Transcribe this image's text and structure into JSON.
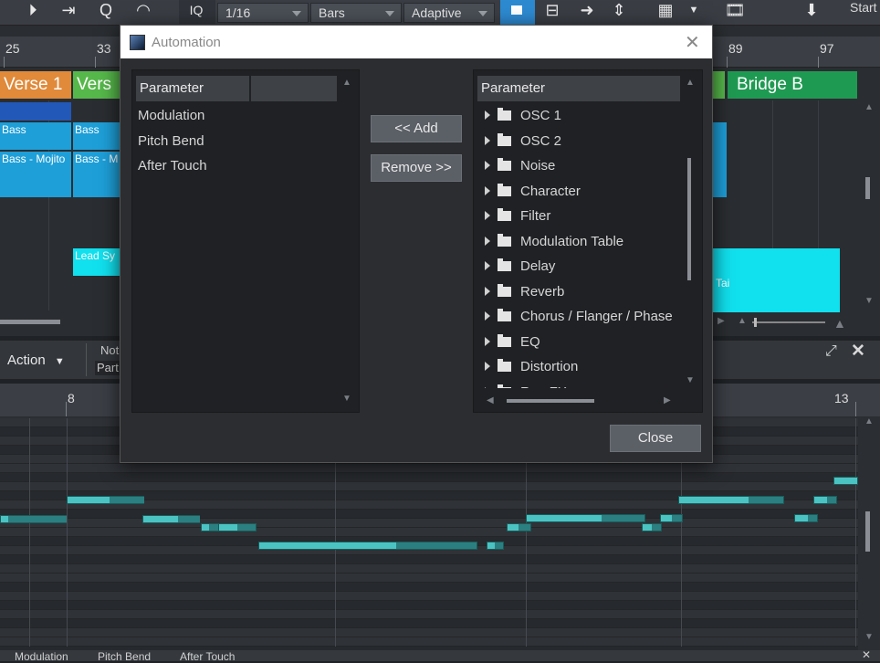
{
  "toolbar": {
    "quantize": "1/16",
    "timebase": "Bars",
    "snap": "Adaptive",
    "iq_label": "IQ",
    "start_label": "Start"
  },
  "arrangement": {
    "ruler": [
      "25",
      "33",
      "89",
      "97"
    ],
    "sections": [
      "Verse 1",
      "Vers",
      "Bridge B"
    ],
    "clips": [
      "Bass",
      "Bass",
      "Bass - Mojito",
      "Bass - M",
      "Lead Sy",
      "Tai"
    ]
  },
  "midbar": {
    "action_label": "Action",
    "note_text_1": "Not",
    "note_text_2": "Part"
  },
  "pianoroll": {
    "ruler": [
      "8",
      "13"
    ]
  },
  "bottom_tabs": [
    "Modulation",
    "Pitch Bend",
    "After Touch"
  ],
  "dialog": {
    "title": "Automation",
    "left_header": "Parameter",
    "left_items": [
      "Modulation",
      "Pitch Bend",
      "After Touch"
    ],
    "add_button": "<< Add",
    "remove_button": "Remove >>",
    "right_header": "Parameter",
    "right_items": [
      "OSC 1",
      "OSC 2",
      "Noise",
      "Character",
      "Filter",
      "Modulation Table",
      "Delay",
      "Reverb",
      "Chorus / Flanger / Phase",
      "EQ",
      "Distortion",
      "Rep FX"
    ],
    "close_button": "Close"
  },
  "colors": {
    "accent_blue": "#1e9fd8",
    "cyan": "#11e0ee",
    "section_orange": "#e08a3a",
    "section_green": "#56b84a",
    "bridge_green": "#1f9a52",
    "note": "#4cc3c3"
  }
}
